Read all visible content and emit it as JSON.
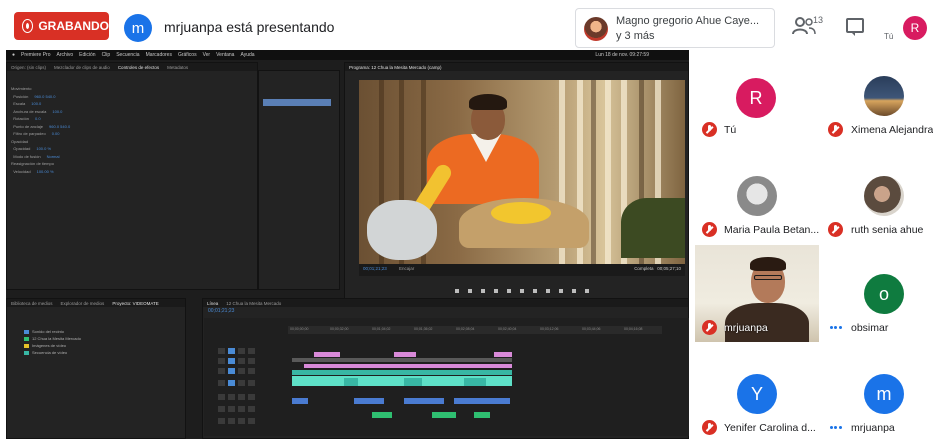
{
  "meet": {
    "recording_label": "GRABANDO",
    "presenter_initial": "m",
    "presenting_text": "mrjuanpa está presentando",
    "active_speaker_name": "Magno gregorio Ahue Caye...",
    "active_speaker_more": "y 3 más",
    "people_count": "13",
    "you_short": "Tú",
    "self_initial": "R",
    "colors": {
      "record_red": "#d93025",
      "blue": "#1a73e8",
      "pink": "#d81b60"
    }
  },
  "participants": [
    {
      "initial": "R",
      "name": "Tú",
      "avatar_color": "#d81b60",
      "mic": "muted"
    },
    {
      "initial": "",
      "name": "Ximena Alejandra",
      "avatar_color": "#2b3a4a",
      "mic": "muted"
    },
    {
      "initial": "",
      "name": "Maria Paula Betan...",
      "avatar_color": "#9e9e9e",
      "mic": "muted"
    },
    {
      "initial": "",
      "name": "ruth senia ahue",
      "avatar_color": "#6b6b6b",
      "mic": "muted"
    },
    {
      "initial": "",
      "name": "mrjuanpa",
      "avatar_color": "",
      "mic": "muted"
    },
    {
      "initial": "o",
      "name": "obsimar",
      "avatar_color": "#0f7b3f",
      "mic": "speaking"
    },
    {
      "initial": "Y",
      "name": "Yenifer Carolina d...",
      "avatar_color": "#1a73e8",
      "mic": "muted"
    },
    {
      "initial": "m",
      "name": "mrjuanpa",
      "avatar_color": "#1a73e8",
      "mic": "speaking"
    }
  ],
  "premiere": {
    "menu": [
      "Premiere Pro",
      "Archivo",
      "Edición",
      "Clip",
      "Secuencia",
      "Marcadores",
      "Gráficos",
      "Ver",
      "Ventana",
      "Ayuda"
    ],
    "clock": "Lun 18 de nov. 09:27:59",
    "top_tabs": [
      "Origen: (sin clips)",
      "Mezclador de clips de audio",
      "Controles de efectos",
      "Metadatos"
    ],
    "program_title": "Programa: 12 Chua la Mesita Mercado (camp)",
    "effects_rows": [
      "Movimiento",
      "Posición",
      "Escala",
      "Anchura de escala",
      "Rotación",
      "Punto de anclaje",
      "Filtro de parpadeo",
      "Opacidad",
      "Modo de fusión",
      "Reasignación de tiempo",
      "Velocidad"
    ],
    "effects_values": [
      "960.0 540.0",
      "100.0",
      "100.0",
      "0.0",
      "960.0 540.0",
      "0.00",
      "100.0 %",
      "Normal",
      "100.00 %"
    ],
    "timecode_left": "00;01;21;23",
    "fit_label": "Encajar",
    "quality_label": "Completa",
    "timecode_right": "00;05;27;10",
    "bottom_tabs": [
      "Biblioteca de medios",
      "Explorador de medios",
      "Proyecto: VIDEOMATE"
    ],
    "timeline_tabs": [
      "Línea",
      "12 Chua la Mesita Mercado"
    ],
    "timeline_timecode": "00;01;21;23",
    "ruler_labels": [
      "00;00;00;00",
      "00;00;32;00",
      "00;01;04;02",
      "00;01;36;02",
      "00;02;08;04",
      "00;02;40;04",
      "00;03;12;06",
      "00;03;44;06",
      "00;04;16;08"
    ],
    "project_items": [
      "Sonido del recinto",
      "12 Chua la Mesita Mercado",
      "Imágenes de vídeo",
      "Secuencia de vídeo"
    ]
  }
}
